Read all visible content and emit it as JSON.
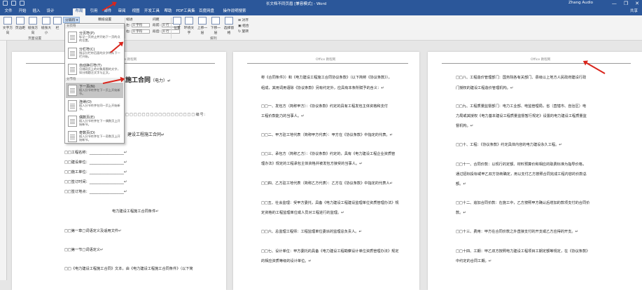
{
  "window": {
    "title": "长文档不同页眉 [兼容模式] - Word",
    "user": "Zhang Audio",
    "minimize": "—",
    "restore": "❐",
    "close": "✕"
  },
  "tabs": [
    "文件",
    "开始",
    "插入",
    "设计",
    "布局",
    "引用",
    "邮件",
    "审阅",
    "视图",
    "开发工具",
    "帮助",
    "PDF工具集",
    "百度网盘",
    "操作说明搜索"
  ],
  "active_tab": "布局",
  "share": "共享",
  "ribbon": {
    "buttons": [
      "文字方向",
      "页边距",
      "纸张方向",
      "纸张大小",
      "栏",
      "分隔符",
      "稿纸设置",
      "位置",
      "环绕文字",
      "上移一层",
      "下移一层",
      "选择窗格",
      "对齐",
      "组合",
      "旋转"
    ],
    "indent_label": "缩进",
    "spacing_label": "间距",
    "left_label": "左:",
    "right_label": "右:",
    "before_label": "段前:",
    "after_label": "段后:",
    "left_value": "0 字符",
    "right_value": "0 字符",
    "before_value": "0 行",
    "after_value": "0 行",
    "group_page_setup": "页面设置",
    "group_arrange": "排列"
  },
  "dropdown": {
    "section_page": "分页符",
    "section_section": "分节符",
    "items": [
      {
        "title": "分页符(P)",
        "desc": "标记一页终止并开始下一页的点的位置。"
      },
      {
        "title": "分栏符(C)",
        "desc": "指示分栏符后面的文字将从下一栏开始。"
      },
      {
        "title": "自动换行符(T)",
        "desc": "分隔网页上的对象周围的文字，如分隔题注文字与正文。"
      },
      {
        "title": "下一页(N)",
        "desc": "插入分节符并在下一页上开始新节。"
      },
      {
        "title": "连续(O)",
        "desc": "插入分节符并在同一页上开始新节。"
      },
      {
        "title": "偶数页(E)",
        "desc": "插入分节符并在下一偶数页上开始新节。"
      },
      {
        "title": "奇数页(D)",
        "desc": "插入分节符并在下一奇数页上开始新节。"
      }
    ]
  },
  "page1": {
    "header": "Office 教程网",
    "title": "施工合同",
    "title_suffix": "（电力）↵",
    "number_line": "编号:",
    "lines": [
      "建设工程施工合同↵",
      "□□工程名称：___________________↵",
      "□□建设单位：___________________↵",
      "□□施工单位：___________________↵",
      "□□签订时间：___________________↵",
      "□□签订地点：___________________↵",
      "电力建设工程施工合同条件↵",
      "□□第一章□词语定义及适用文件↵",
      "□□第一节□词语定义↵",
      "□□《电力建设工程施工合同》文本，由《电力建设工程施工合同条件》（以下简"
    ]
  },
  "page2": {
    "header": "Office 教程网",
    "lines": [
      "称《合同条件》）和《电力建设工程施工合同协议条款》（以下简称《协议条款》），",
      "组成，其用词用语除《协议条款》另有约定外，应具有本条所赋予的含义：↵",
      "□□一、发包方（简称甲方）：《协议条款》约定的具有工程发包主体资格和支付",
      "工程价款能力的当事人。↵",
      "□□二、甲方驻工地代表（简称甲方代表）：甲方在《协议条款》中指定的代表。↵",
      "□□三、承包方（简称乙方）：《协议条款》约定的，具有《电力建设工程企业资质管",
      "理办法》规定的工程承包主体资格并被发包方接受的当事人。↵",
      "□□四、乙方驻工地代表（简称乙方代表）：乙方在《协议条款》中指定的代表人↵",
      "□□五、社会监理：受甲方委托，具备《电力建设工程建设监理单位资质管理办法》规",
      "定资格的工程监理单位或人员对工程进行的监理。↵",
      "□□六、总监理工程师：工程监理单位委派的监理总负责人。↵",
      "□□七、设计单位：甲方委托的具备《电力建设工程勘察设计单位资质管理办法》规定",
      "的相应资质等级的设计单位。↵"
    ]
  },
  "page3": {
    "header": "Office 教程网",
    "lines": [
      "□□八、工程造价管理部门：国务院各有关部门、县级以上地方人民政府建设行政",
      "门授权的建设工程造价管理机构。↵",
      "□□九、工程质量监督部门：电力工业部、电监管理局，省（直辖市、自治区）电",
      "力局或其授权《电力基本建设工程质量监督暂行规定》设置的电力建设工程质量监",
      "督机构。↵",
      "□□十、工程：《协议条款》约定具体内容的电力建设永久工程。↵",
      "□□十一、合同价款：以现行的定额、材料预算价和相应的取费标准为指导价格，",
      "通过招标投标或甲乙双方协商确定，用以支付乙方按照合同完成工程内容的价款总",
      "额。↵",
      "□□十二、追加合同价款：在施工中，乙方按照甲方确认后增加的款项支付的合同价",
      "款。↵",
      "□□十三、费用：甲方在合同价款之外直接支付的开支或乙方应得的开支。↵",
      "□□十四、工期：甲乙双方按照电力建设工程项目工期定额等规定，在《协议条款》",
      "中约定的合同工期。↵"
    ]
  }
}
